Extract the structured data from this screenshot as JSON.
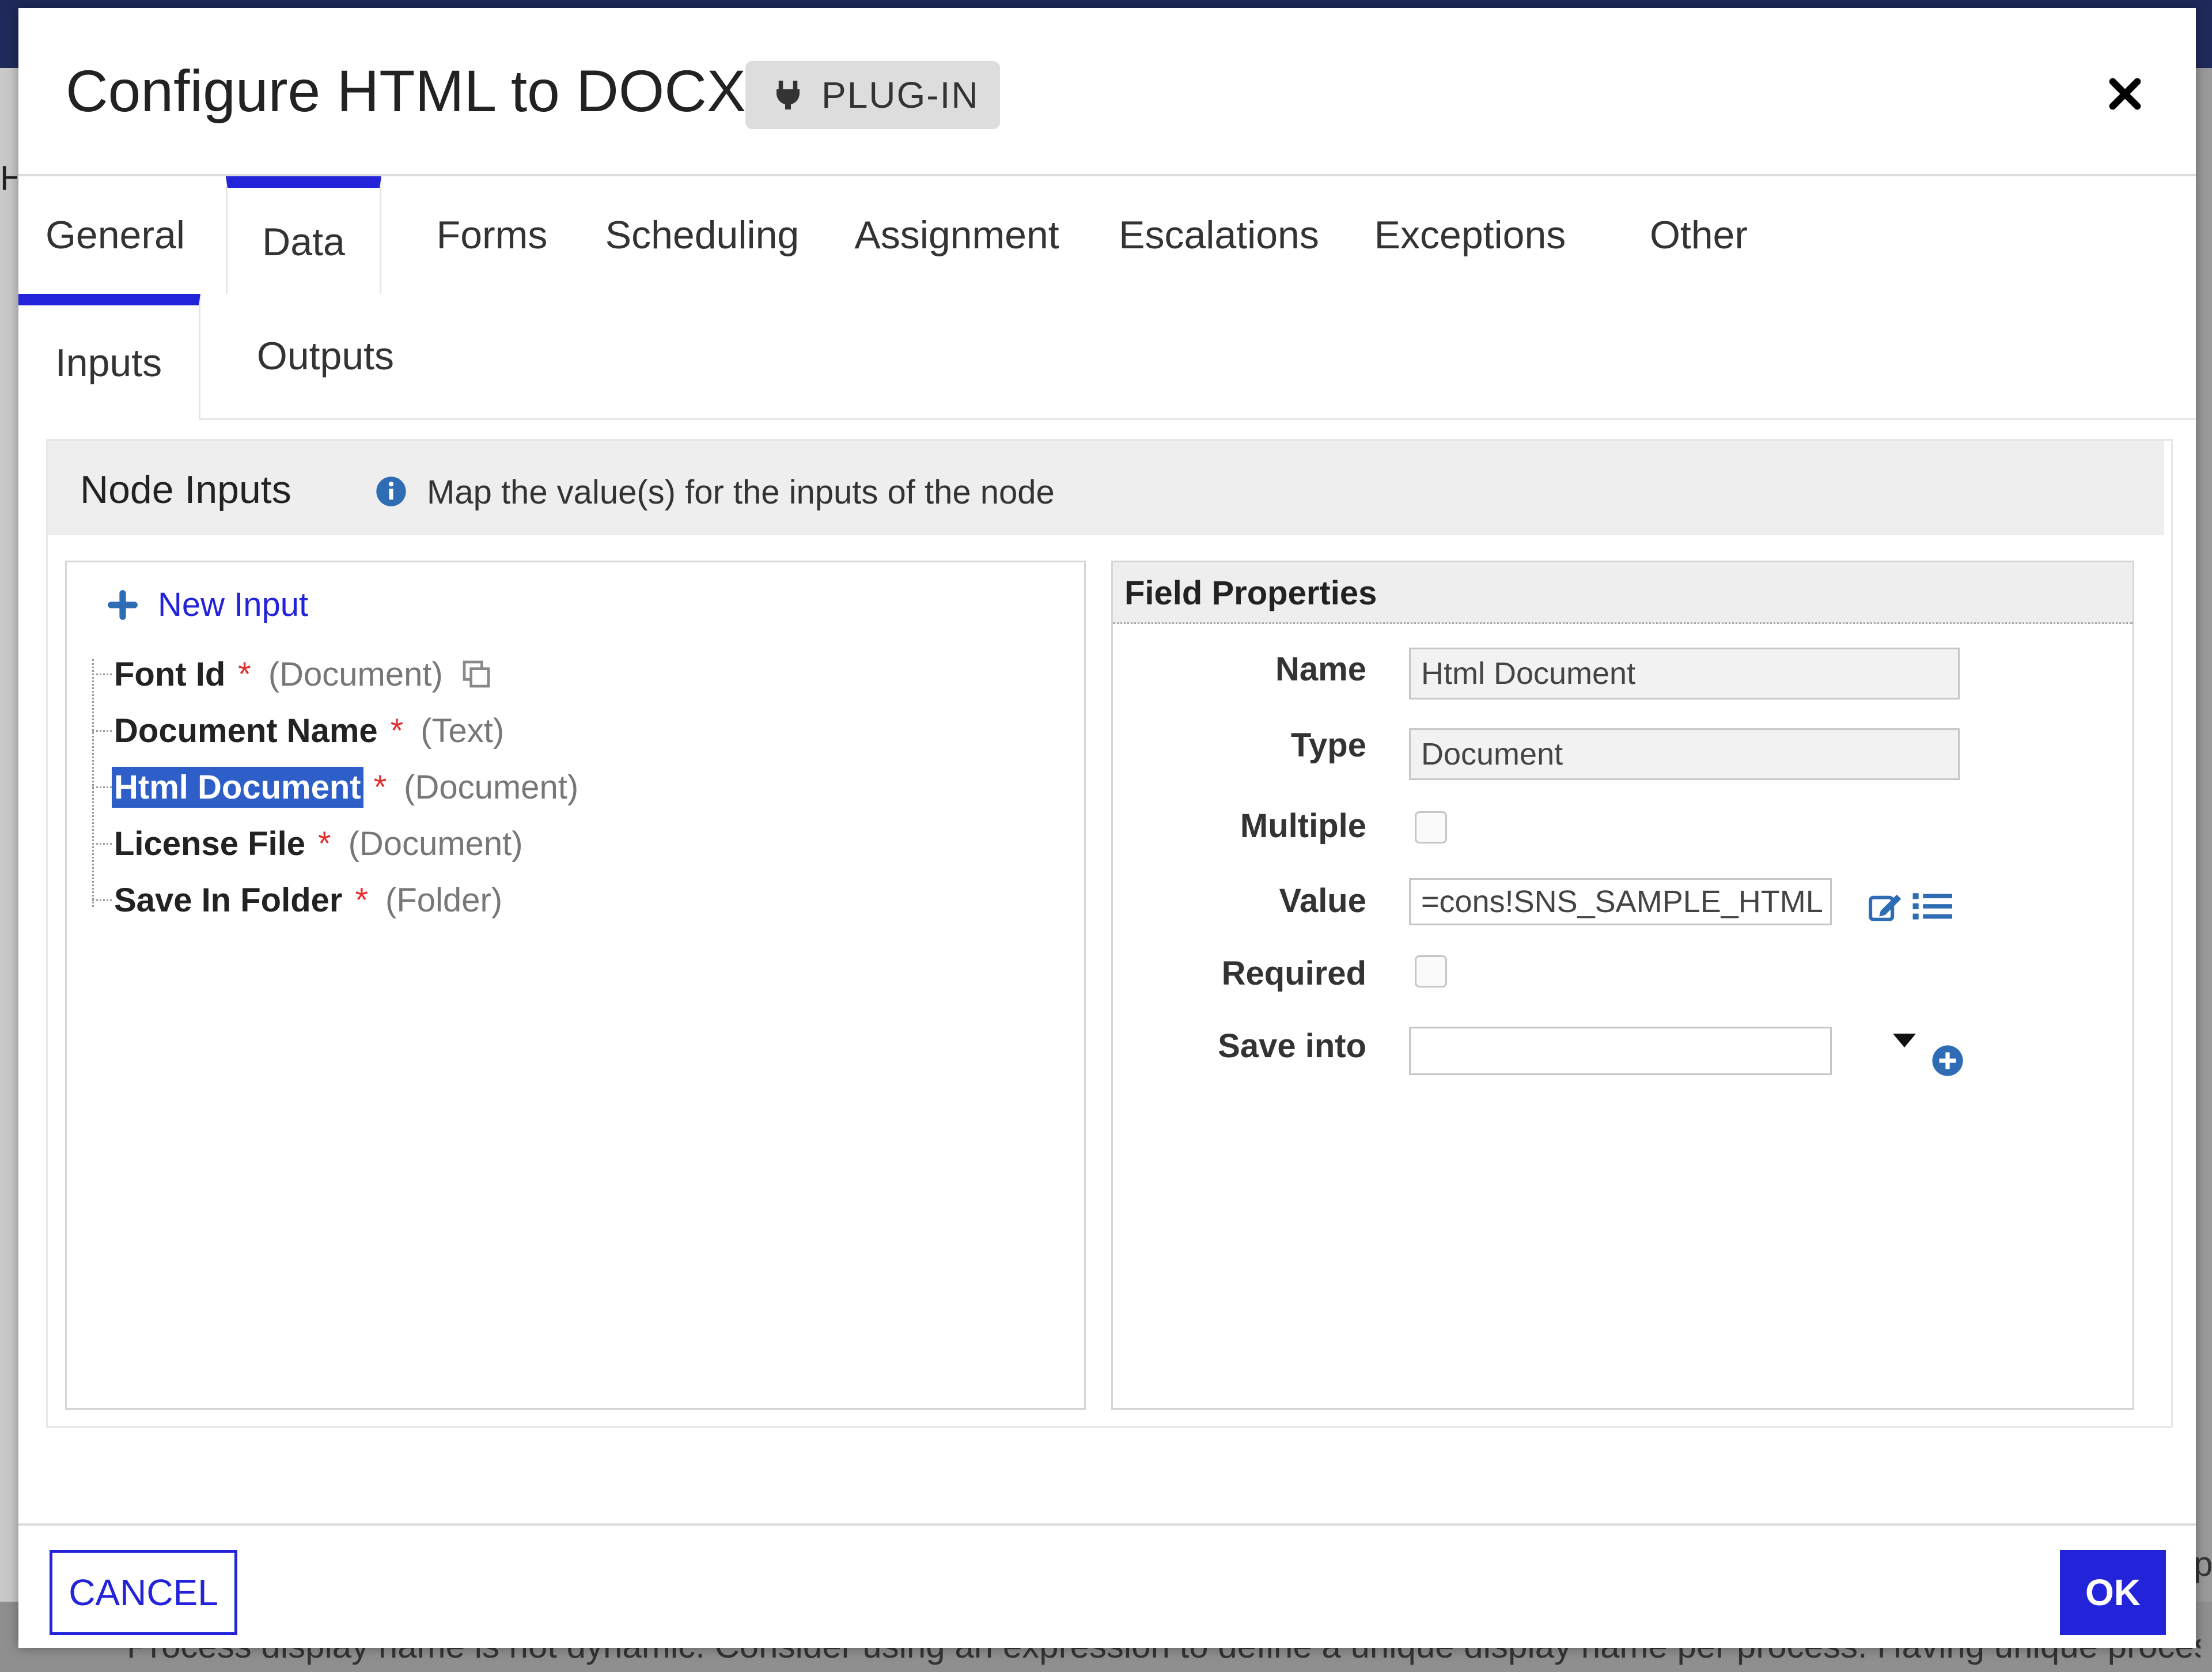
{
  "background": {
    "bottom_text": "Process display name is not dynamic. Consider using an expression to define a unique display name per process. Having unique process display n",
    "right_edge_char": "p",
    "left_edge_char": "HH"
  },
  "dialog": {
    "title": "Configure HTML to DOCX",
    "badge": "PLUG-IN",
    "close_icon": "close-icon"
  },
  "tabs": [
    {
      "label": "General"
    },
    {
      "label": "Data"
    },
    {
      "label": "Forms"
    },
    {
      "label": "Scheduling"
    },
    {
      "label": "Assignment"
    },
    {
      "label": "Escalations"
    },
    {
      "label": "Exceptions"
    },
    {
      "label": "Other"
    }
  ],
  "active_tab": "Data",
  "subtabs": [
    {
      "label": "Inputs"
    },
    {
      "label": "Outputs"
    }
  ],
  "active_subtab": "Inputs",
  "node_inputs": {
    "title": "Node Inputs",
    "info": "Map the value(s) for the inputs of the node",
    "new_input_label": "New Input",
    "items": [
      {
        "name": "Font Id",
        "required": "*",
        "type": "(Document)"
      },
      {
        "name": "Document Name",
        "required": "*",
        "type": "(Text)"
      },
      {
        "name": "Html Document",
        "required": "*",
        "type": "(Document)"
      },
      {
        "name": "License File",
        "required": "*",
        "type": "(Document)"
      },
      {
        "name": "Save In Folder",
        "required": "*",
        "type": "(Folder)"
      }
    ],
    "selected_item": "Html Document"
  },
  "field_properties": {
    "title": "Field Properties",
    "name_label": "Name",
    "name_value": "Html Document",
    "type_label": "Type",
    "type_value": "Document",
    "multiple_label": "Multiple",
    "value_label": "Value",
    "value_value": "=cons!SNS_SAMPLE_HTML",
    "required_label": "Required",
    "save_into_label": "Save into",
    "save_into_value": ""
  },
  "footer": {
    "cancel_label": "CANCEL",
    "ok_label": "OK"
  },
  "colors": {
    "accent": "#2323d9",
    "selection": "#2e5fc9",
    "required": "#e03030"
  }
}
